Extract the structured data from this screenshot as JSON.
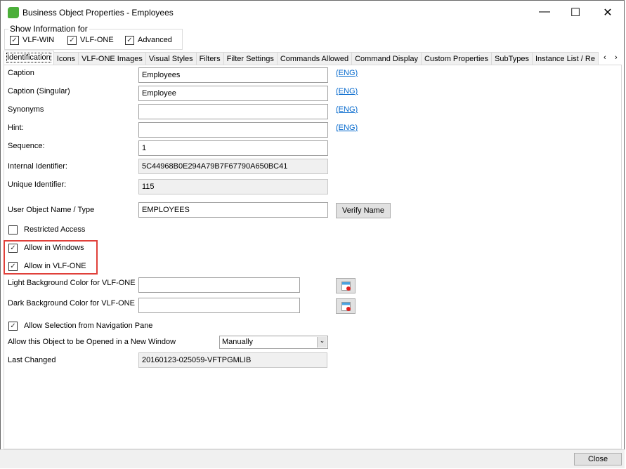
{
  "window": {
    "title": "Business Object Properties - Employees"
  },
  "show_info": {
    "label": "Show Information for",
    "options": [
      {
        "label": "VLF-WIN",
        "checked": true
      },
      {
        "label": "VLF-ONE",
        "checked": true
      },
      {
        "label": "Advanced",
        "checked": true
      }
    ]
  },
  "tabs": [
    "Identification",
    "Icons",
    "VLF-ONE Images",
    "Visual Styles",
    "Filters",
    "Filter Settings",
    "Commands Allowed",
    "Command Display",
    "Custom Properties",
    "SubTypes",
    "Instance List / Re"
  ],
  "active_tab": "Identification",
  "form": {
    "caption": {
      "label": "Caption",
      "value": "Employees",
      "link": "(ENG)"
    },
    "caption_singular": {
      "label": "Caption (Singular)",
      "value": "Employee",
      "link": "(ENG)"
    },
    "synonyms": {
      "label": "Synonyms",
      "value": "",
      "link": "(ENG)"
    },
    "hint": {
      "label": "Hint:",
      "value": "",
      "link": "(ENG)"
    },
    "sequence": {
      "label": "Sequence:",
      "value": "1"
    },
    "internal_id": {
      "label": "Internal Identifier:",
      "value": "5C44968B0E294A79B7F67790A650BC41"
    },
    "unique_id": {
      "label": "Unique Identifier:",
      "value": "115"
    },
    "user_object": {
      "label": "User Object Name / Type",
      "value": "EMPLOYEES",
      "button": "Verify Name"
    },
    "restricted": {
      "label": "Restricted Access",
      "checked": false
    },
    "allow_windows": {
      "label": "Allow in Windows",
      "checked": true
    },
    "allow_vlfone": {
      "label": "Allow in VLF-ONE",
      "checked": true
    },
    "light_bg": {
      "label": "Light Background Color for VLF-ONE",
      "value": ""
    },
    "dark_bg": {
      "label": "Dark Background Color for VLF-ONE",
      "value": ""
    },
    "allow_selection": {
      "label": "Allow Selection from Navigation Pane",
      "checked": true
    },
    "new_window": {
      "label": "Allow this Object to be Opened in a New Window",
      "value": "Manually"
    },
    "last_changed": {
      "label": "Last Changed",
      "value": "20160123-025059-VFTPGMLIB"
    }
  },
  "footer": {
    "close": "Close"
  },
  "colors": {
    "highlight": "#e0403a",
    "link": "#0066cc"
  }
}
